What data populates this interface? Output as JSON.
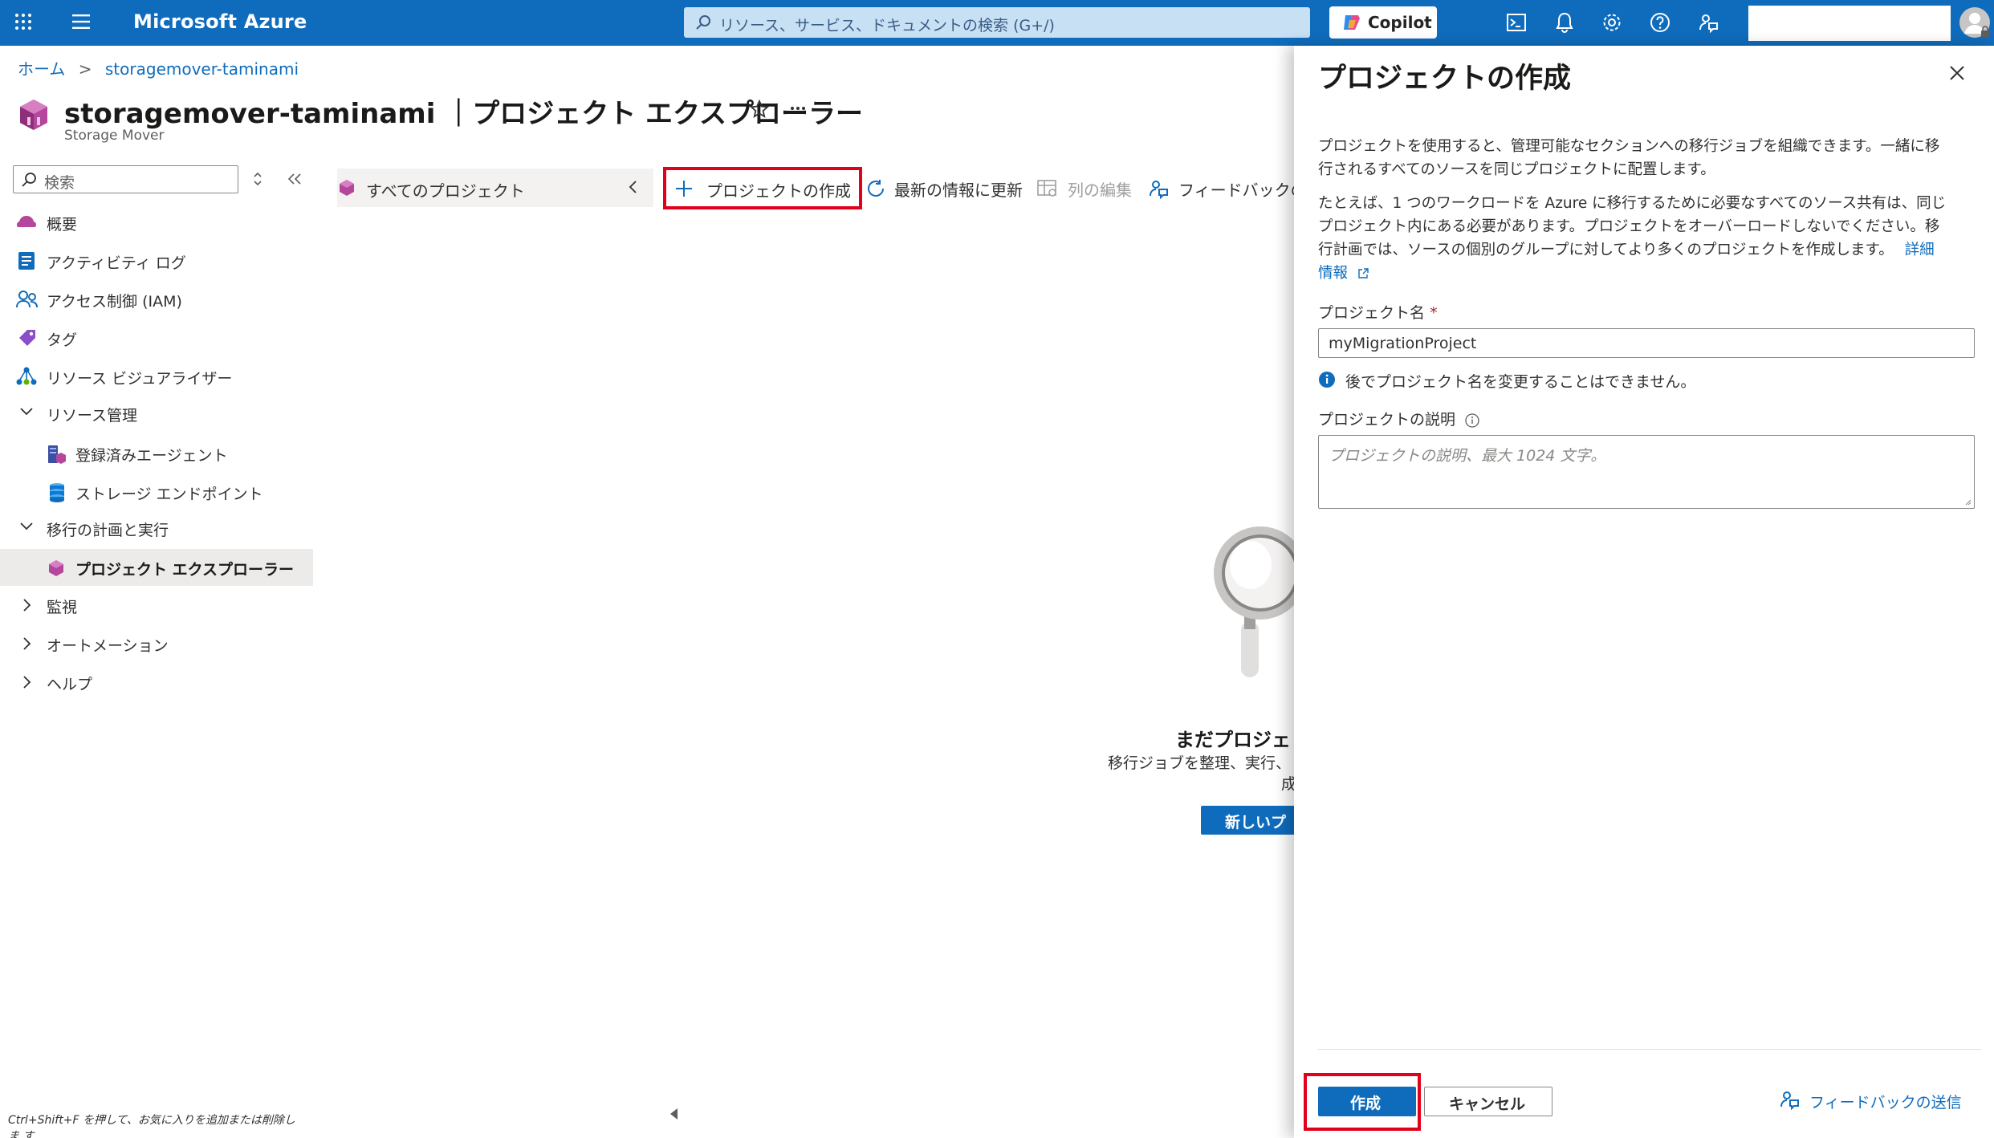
{
  "topbar": {
    "brand": "Microsoft Azure",
    "search_placeholder": "リソース、サービス、ドキュメントの検索 (G+/)",
    "copilot_label": "Copilot"
  },
  "breadcrumb": {
    "home": "ホーム",
    "separator": ">",
    "current": "storagemover-taminami"
  },
  "page": {
    "title": "storagemover-taminami ｜プロジェクト エクスプローラー",
    "subtitle": "Storage Mover"
  },
  "nav": {
    "search_placeholder": "検索",
    "items": [
      {
        "label": "概要"
      },
      {
        "label": "アクティビティ ログ"
      },
      {
        "label": "アクセス制御 (IAM)"
      },
      {
        "label": "タグ"
      },
      {
        "label": "リソース ビジュアライザー"
      },
      {
        "label": "リソース管理"
      },
      {
        "label": "登録済みエージェント"
      },
      {
        "label": "ストレージ エンドポイント"
      },
      {
        "label": "移行の計画と実行"
      },
      {
        "label": "プロジェクト エクスプローラー"
      },
      {
        "label": "監視"
      },
      {
        "label": "オートメーション"
      },
      {
        "label": "ヘルプ"
      }
    ],
    "footer_hint": "Ctrl+Shift+F を押して、お気に入りを追加または削除しま す"
  },
  "project_list": {
    "header": "すべてのプロジェクト"
  },
  "toolbar": {
    "create_project": "プロジェクトの作成",
    "refresh": "最新の情報に更新",
    "edit_columns": "列の編集",
    "feedback": "フィードバックの"
  },
  "empty_state": {
    "title": "まだプロジェ",
    "desc_line1": "移行ジョブを整理、実行、",
    "desc_line2": "成",
    "button": "新しいプ"
  },
  "panel": {
    "title": "プロジェクトの作成",
    "para1_line1": "プロジェクトを使用すると、管理可能なセクションへの移行ジョブを組織できます。一緒に移",
    "para1_line2": "行されるすべてのソースを同じプロジェクトに配置します。",
    "para2_line1": "たとえば、1 つのワークロードを Azure に移行するために必要なすべてのソース共有は、同じ",
    "para2_line2": "プロジェクト内にある必要があります。プロジェクトをオーバーロードしないでください。移",
    "para2_line3": "行計画では、ソースの個別のグループに対してより多くのプロジェクトを作成します。",
    "learn_more_1": "詳細",
    "learn_more_2": "情報",
    "name_label": "プロジェクト名",
    "required_mark": "*",
    "name_value": "myMigrationProject",
    "name_note": "後でプロジェクト名を変更することはできません。",
    "desc_label": "プロジェクトの説明",
    "desc_placeholder": "プロジェクトの説明、最大 1024 文字。",
    "create_button": "作成",
    "cancel_button": "キャンセル",
    "feedback_link": "フィードバックの送信"
  },
  "colors": {
    "azure_blue": "#0f6cbd",
    "highlight_red": "#e3001b",
    "storage_mover_purple": "#b4479c"
  }
}
